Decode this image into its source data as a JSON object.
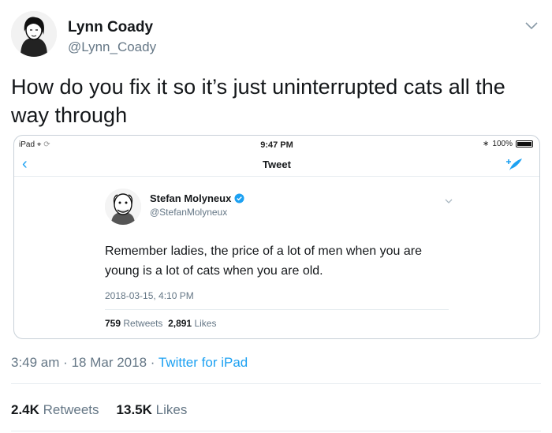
{
  "author": {
    "name": "Lynn Coady",
    "handle": "@Lynn_Coady"
  },
  "tweet": {
    "text": "How do you fix it so it’s just uninterrupted cats all the way through",
    "time": "3:49 am",
    "date": "18 Mar 2018",
    "source": "Twitter for iPad",
    "separator": "·",
    "retweets_count": "2.4K",
    "retweets_label": "Retweets",
    "likes_count": "13.5K",
    "likes_label": "Likes"
  },
  "screenshot": {
    "statusbar": {
      "device": "iPad",
      "time": "9:47 PM",
      "battery": "100%"
    },
    "nav_title": "Tweet",
    "author": {
      "name": "Stefan Molyneux",
      "handle": "@StefanMolyneux"
    },
    "text": "Remember ladies, the price of a lot of men when you are young is a lot of cats when you are old.",
    "timestamp": "2018-03-15, 4:10 PM",
    "retweets_count": "759",
    "retweets_label": "Retweets",
    "likes_count": "2,891",
    "likes_label": "Likes"
  },
  "colors": {
    "link": "#1da1f2",
    "muted": "#657786",
    "text": "#14171a"
  }
}
